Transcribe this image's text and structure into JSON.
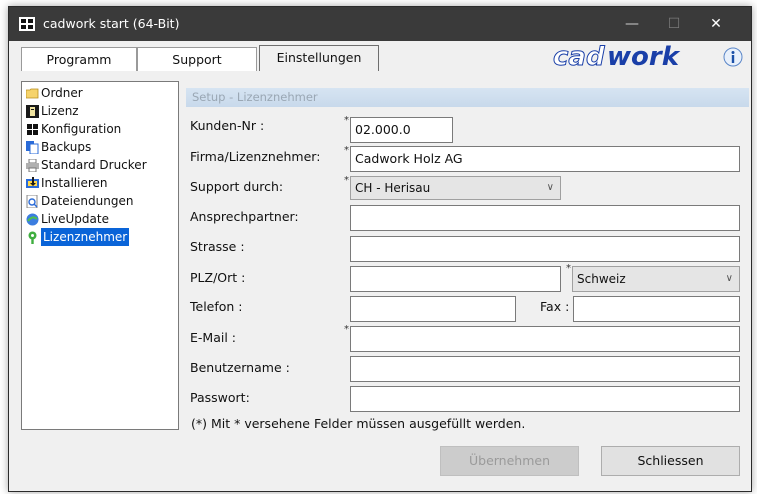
{
  "window": {
    "title": "cadwork start (64-Bit)",
    "minimize_glyph": "—",
    "maximize_glyph": "☐",
    "close_glyph": "✕"
  },
  "tabs": [
    {
      "label": "Programm",
      "active": false
    },
    {
      "label": "Support",
      "active": false
    },
    {
      "label": "Einstellungen",
      "active": true
    }
  ],
  "logo_text": "cadwork",
  "tree": [
    {
      "label": "Ordner",
      "icon": "folder-icon",
      "selected": false
    },
    {
      "label": "Lizenz",
      "icon": "license-icon",
      "selected": false
    },
    {
      "label": "Konfiguration",
      "icon": "configuration-icon",
      "selected": false
    },
    {
      "label": "Backups",
      "icon": "backup-icon",
      "selected": false
    },
    {
      "label": "Standard Drucker",
      "icon": "printer-icon",
      "selected": false
    },
    {
      "label": "Installieren",
      "icon": "install-icon",
      "selected": false
    },
    {
      "label": "Dateiendungen",
      "icon": "file-extensions-icon",
      "selected": false
    },
    {
      "label": "LiveUpdate",
      "icon": "liveupdate-icon",
      "selected": false
    },
    {
      "label": "Lizenznehmer",
      "icon": "licensee-icon",
      "selected": true
    }
  ],
  "section_title": "Setup - Lizenznehmer",
  "form": {
    "kunden_nr": {
      "label": "Kunden-Nr :",
      "value": "02.000.0",
      "required": "*"
    },
    "firma": {
      "label": "Firma/Lizenznehmer:",
      "value": "Cadwork Holz AG",
      "required": "*"
    },
    "support": {
      "label": "Support durch:",
      "value": "CH - Herisau",
      "required": "*"
    },
    "ansprechpartner": {
      "label": "Ansprechpartner:",
      "value": ""
    },
    "strasse": {
      "label": "Strasse :",
      "value": ""
    },
    "plz_ort": {
      "label": "PLZ/Ort :",
      "value": ""
    },
    "land": {
      "value": "Schweiz",
      "required": "*"
    },
    "telefon": {
      "label": "Telefon :",
      "value": ""
    },
    "fax": {
      "label": "Fax :",
      "value": ""
    },
    "email": {
      "label": "E-Mail :",
      "value": "",
      "required": "*"
    },
    "benutzername": {
      "label": "Benutzername :",
      "value": ""
    },
    "passwort": {
      "label": "Passwort:",
      "value": ""
    }
  },
  "note": "(*) Mit * versehene Felder müssen ausgefüllt werden.",
  "buttons": {
    "apply": "Übernehmen",
    "close": "Schliessen"
  },
  "chevron_glyph": "∨",
  "colors": {
    "titlebar": "#3a3a3a",
    "selection": "#0a64d8",
    "section_bar": "#c8d9eb",
    "logo_blue": "#1a3fa8"
  }
}
